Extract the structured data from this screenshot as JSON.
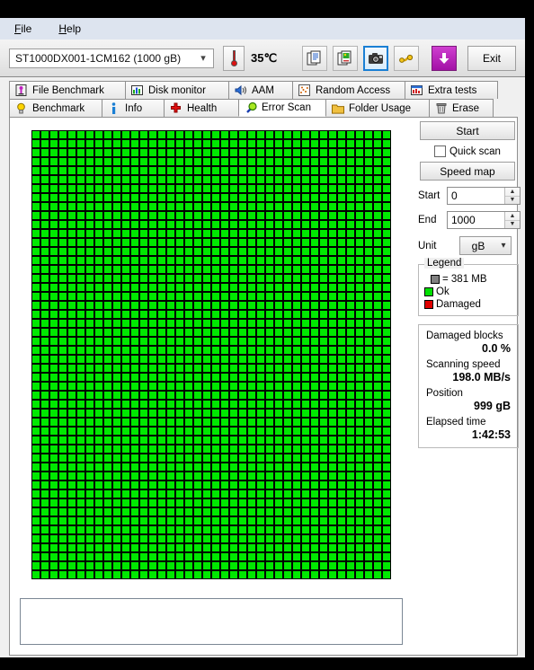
{
  "menu": {
    "items": [
      {
        "label": "File",
        "accel": "F"
      },
      {
        "label": "Help",
        "accel": "H"
      }
    ]
  },
  "toolbar": {
    "disk_selected": "ST1000DX001-1CM162 (1000 gB)",
    "dropdown_icon": "chevron-down-icon",
    "temperature": "35℃",
    "thermometer_icon": "thermometer-icon",
    "buttons": [
      {
        "name": "copy-text-button",
        "icon": "text-document-copy-icon"
      },
      {
        "name": "copy-image-button",
        "icon": "image-document-copy-icon"
      },
      {
        "name": "screenshot-button",
        "icon": "camera-icon",
        "selected": true
      },
      {
        "name": "network-button",
        "icon": "plug-cable-icon"
      },
      {
        "name": "download-button",
        "icon": "down-arrow-icon"
      }
    ],
    "exit_label": "Exit"
  },
  "tabs": {
    "row1": [
      {
        "label": "File Benchmark",
        "icon": "file-benchmark-icon",
        "active": false
      },
      {
        "label": "Disk monitor",
        "icon": "bar-chart-icon",
        "active": false
      },
      {
        "label": "AAM",
        "icon": "speaker-icon",
        "active": false
      },
      {
        "label": "Random Access",
        "icon": "scatter-icon",
        "active": false
      },
      {
        "label": "Extra tests",
        "icon": "extra-tests-icon",
        "active": false
      }
    ],
    "row2": [
      {
        "label": "Benchmark",
        "icon": "lightbulb-icon",
        "active": false
      },
      {
        "label": "Info",
        "icon": "info-icon",
        "active": false
      },
      {
        "label": "Health",
        "icon": "red-cross-icon",
        "active": false
      },
      {
        "label": "Error Scan",
        "icon": "magnifier-icon",
        "active": true
      },
      {
        "label": "Folder Usage",
        "icon": "folder-icon",
        "active": false
      },
      {
        "label": "Erase",
        "icon": "trash-icon",
        "active": false
      }
    ]
  },
  "panel": {
    "start_button": "Start",
    "quick_scan_label": "Quick scan",
    "quick_scan_checked": false,
    "speed_map_button": "Speed map",
    "start_field": {
      "label": "Start",
      "value": "0"
    },
    "end_field": {
      "label": "End",
      "value": "1000"
    },
    "unit_field": {
      "label": "Unit",
      "value": "gB"
    },
    "legend": {
      "title": "Legend",
      "block_size": "= 381 MB",
      "block_color": "#808080",
      "ok_label": "Ok",
      "ok_color": "#00e000",
      "damaged_label": "Damaged",
      "damaged_color": "#e00000"
    },
    "stats": [
      {
        "label": "Damaged blocks",
        "value": "0.0 %"
      },
      {
        "label": "Scanning speed",
        "value": "198.0 MB/s"
      },
      {
        "label": "Position",
        "value": "999 gB"
      },
      {
        "label": "Elapsed time",
        "value": "1:42:53"
      }
    ]
  },
  "grid": {
    "columns": 40,
    "rows": 50,
    "ok_color": "#00e800",
    "grid_line_color": "#000000"
  },
  "log": {
    "text": ""
  }
}
